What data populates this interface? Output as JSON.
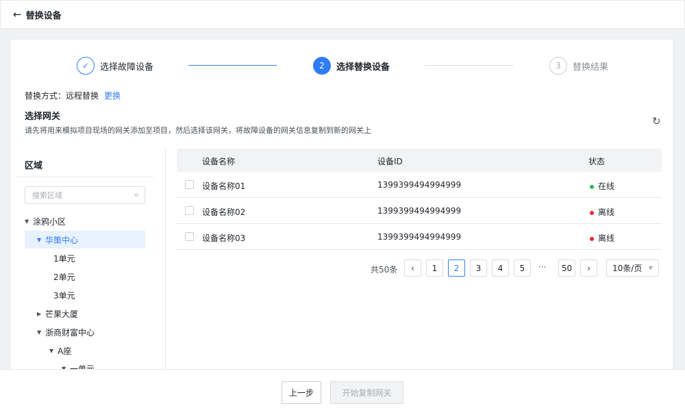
{
  "header": {
    "title": "替换设备",
    "back_icon": "arrow-left-icon"
  },
  "steps": [
    {
      "index": "✓",
      "label": "选择故障设备",
      "state": "done"
    },
    {
      "index": "2",
      "label": "选择替换设备",
      "state": "active"
    },
    {
      "index": "3",
      "label": "替换结果",
      "state": "wait"
    }
  ],
  "method": {
    "label": "替换方式：远程替换",
    "change_link": "更换"
  },
  "section": {
    "title": "选择网关",
    "description": "请先将用来模拟项目现场的网关添加至项目，然后选择该网关，将故障设备的网关信息复制到新的网关上"
  },
  "region": {
    "title": "区域",
    "search_placeholder": "搜索区域",
    "tree": [
      {
        "label": "涂鸦小区",
        "caret": "▼",
        "selected": false
      },
      {
        "label": "华策中心",
        "caret": "▼",
        "selected": true
      },
      {
        "label": "1单元",
        "caret": "",
        "selected": false
      },
      {
        "label": "2单元",
        "caret": "",
        "selected": false
      },
      {
        "label": "3单元",
        "caret": "",
        "selected": false
      },
      {
        "label": "芒果大厦",
        "caret": "▶",
        "selected": false
      },
      {
        "label": "浙商财富中心",
        "caret": "▼",
        "selected": false
      },
      {
        "label": "A座",
        "caret": "▼",
        "selected": false
      },
      {
        "label": "一单元",
        "caret": "▼",
        "selected": false
      }
    ]
  },
  "table": {
    "columns": [
      "设备名称",
      "设备ID",
      "状态"
    ],
    "rows": [
      {
        "name": "设备名称01",
        "id": "1399399494994999",
        "status": "在线",
        "status_color": "#2db84d"
      },
      {
        "name": "设备名称02",
        "id": "1399399494994999",
        "status": "离线",
        "status_color": "#f5222d"
      },
      {
        "name": "设备名称03",
        "id": "1399399494994999",
        "status": "离线",
        "status_color": "#f5222d"
      }
    ]
  },
  "pagination": {
    "total": "共50条",
    "prev_icon": "‹",
    "next_icon": "›",
    "pages": [
      "1",
      "2",
      "3",
      "4",
      "5"
    ],
    "ellipsis": "···",
    "last": "50",
    "current": "2",
    "page_size": "10条/页"
  },
  "footer": {
    "prev_label": "上一步",
    "copy_label": "开始复制网关"
  },
  "colors": {
    "primary": "#2f7cf6",
    "online": "#2db84d",
    "offline": "#f5222d"
  }
}
